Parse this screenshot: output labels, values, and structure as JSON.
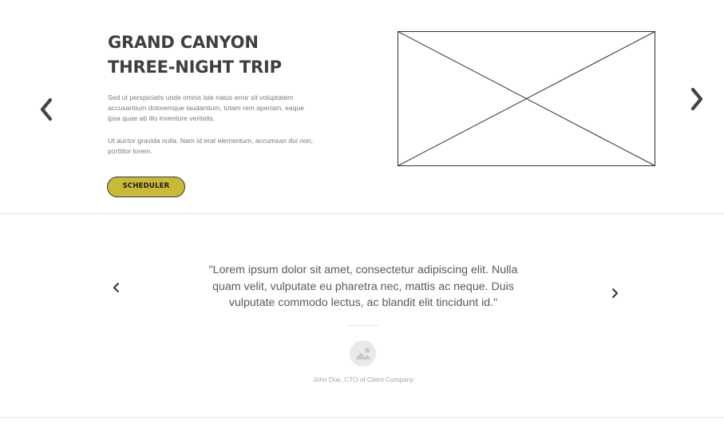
{
  "hero": {
    "title": "GRAND CANYON THREE-NIGHT TRIP",
    "paragraph_1": "Sed ut perspiciatis unde omnis iste natus error sit voluptatem accusantium doloremque laudantium, totam rem aperiam, eaque ipsa quae ab illo inventore veritatis.",
    "paragraph_2": "Ut auctor gravida nulla. Nam id erat elementum, accumsan dui non, porttitor lorem.",
    "button_label": "SCHEDULER",
    "button_color": "#c8b937",
    "prev_icon": "chevron-left-icon",
    "next_icon": "chevron-right-icon"
  },
  "testimonial": {
    "quote": "\"Lorem ipsum dolor sit amet, consectetur adipiscing elit. Nulla quam velit, vulputate eu pharetra nec, mattis ac neque. Duis vulputate commodo lectus, ac blandit elit tincidunt id.\"",
    "author": "John Doe, CTO of Client Company",
    "avatar_icon": "image-placeholder-icon",
    "prev_icon": "chevron-left-icon",
    "next_icon": "chevron-right-icon"
  }
}
